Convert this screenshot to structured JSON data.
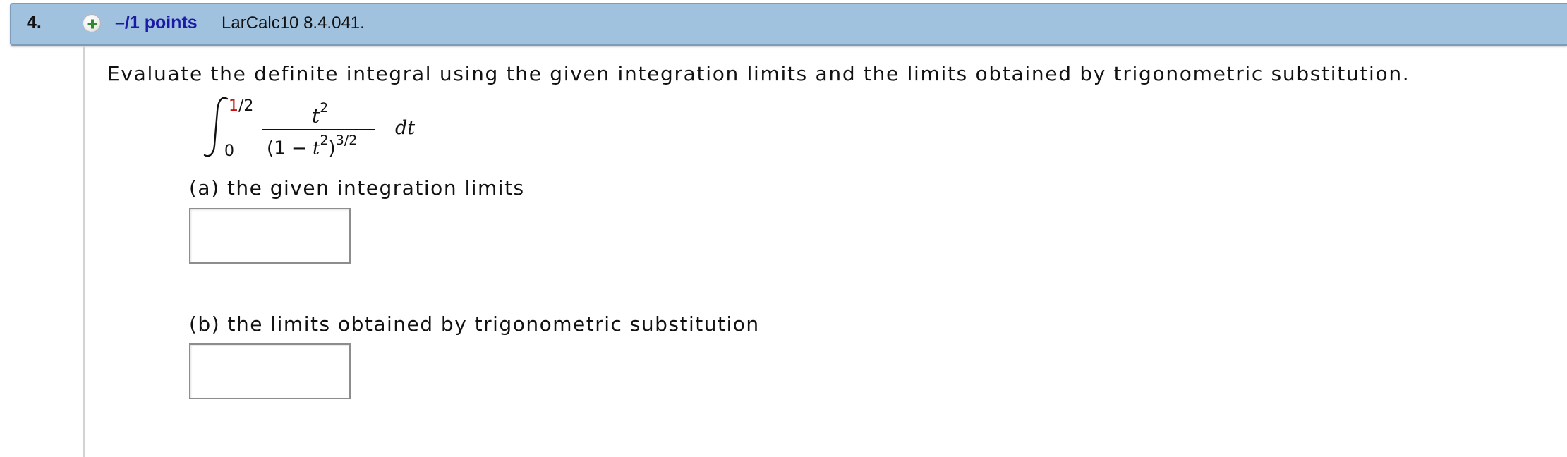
{
  "header": {
    "question_number": "4.",
    "points_label": "–/1 points",
    "assignment_id": "LarCalc10 8.4.041."
  },
  "question": {
    "prompt": "Evaluate the definite integral using the given integration limits and the limits obtained by trigonometric substitution.",
    "integral": {
      "upper_limit_red": "1",
      "upper_limit_rest": "/2",
      "lower_limit": "0",
      "numerator_var": "t",
      "numerator_exp": "2",
      "denominator_open": "(1 − ",
      "denominator_var": "t",
      "denominator_inner_exp": "2",
      "denominator_close": ")",
      "denominator_exp": "3/2",
      "differential": "dt"
    },
    "parts": [
      {
        "label": "(a) the given integration limits",
        "answer_value": ""
      },
      {
        "label": "(b) the limits obtained by trigonometric substitution",
        "answer_value": ""
      }
    ]
  },
  "colors": {
    "header_bg": "#a1c2df",
    "points_link": "#1a1aa6",
    "limit_highlight": "#cc1111",
    "plus_icon": "#2e8b2e"
  },
  "icons": {
    "expand": "plus-circle-icon"
  }
}
